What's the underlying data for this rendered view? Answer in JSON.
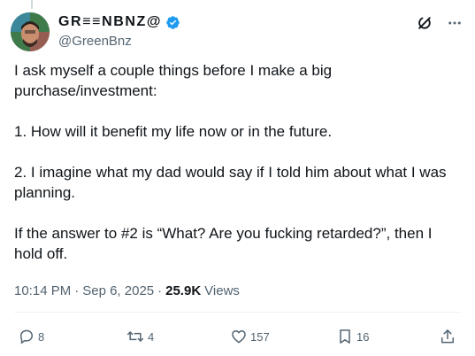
{
  "tweet": {
    "author": {
      "display_name": "GR≡≡NBNZ@",
      "handle": "@GreenBnz",
      "verified": true
    },
    "body": [
      "I ask myself a couple things before I make a big purchase/investment:",
      "1. How will it benefit my life now or in the future.",
      "2. I imagine what my dad would say if I told him about what I was planning.",
      "If the answer to #2 is “What? Are you fucking retarded?”, then I hold off."
    ],
    "meta": {
      "time": "10:14 PM",
      "separator": "·",
      "date": "Sep 6, 2025",
      "separator2": "·",
      "views_count": "25.9K",
      "views_label": "Views"
    },
    "actions": {
      "replies": "8",
      "reposts": "4",
      "likes": "157",
      "bookmarks": "16"
    }
  },
  "icons": {
    "verified": "verified-badge-icon",
    "grok": "grok-icon",
    "more": "more-icon",
    "reply": "reply-icon",
    "repost": "repost-icon",
    "like": "heart-icon",
    "bookmark": "bookmark-icon",
    "share": "share-icon"
  },
  "colors": {
    "text": "#0f1419",
    "secondary": "#536471",
    "verified": "#1d9bf0"
  }
}
